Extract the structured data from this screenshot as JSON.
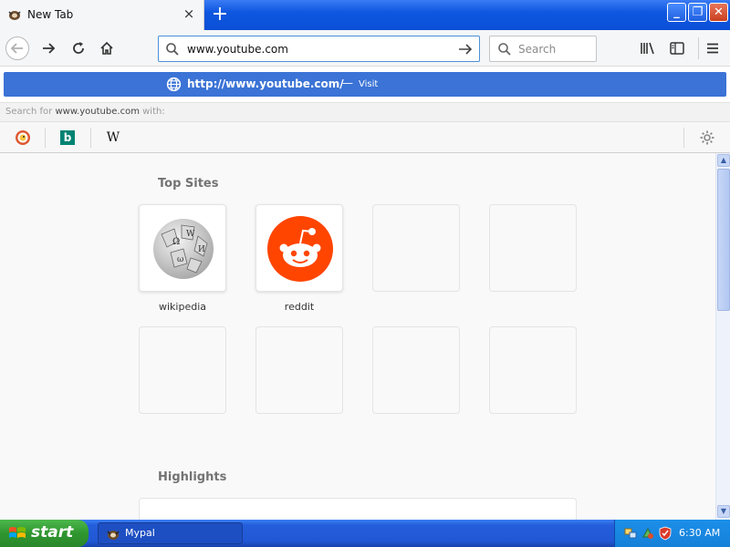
{
  "tab": {
    "title": "New Tab",
    "close": "×",
    "new_tab": "+"
  },
  "window_buttons": {
    "minimize": "_",
    "maximize": "❐",
    "close": "✕"
  },
  "urlbar": {
    "value": "www.youtube.com"
  },
  "searchbar": {
    "placeholder": "Search"
  },
  "autocomplete": {
    "url": "http://www.youtube.com/",
    "separator": "—",
    "action": "Visit"
  },
  "search_with": {
    "prefix": "Search for ",
    "term": "www.youtube.com",
    "suffix": " with:"
  },
  "engines": [
    {
      "name": "DuckDuckGo",
      "icon": "duckduckgo-icon"
    },
    {
      "name": "Bing",
      "icon": "bing-icon",
      "glyph": "b"
    },
    {
      "name": "Wikipedia",
      "icon": "wikipedia-icon",
      "glyph": "W"
    }
  ],
  "content": {
    "top_sites_title": "Top Sites",
    "top_sites": [
      {
        "label": "wikipedia",
        "icon": "wikipedia-globe-icon"
      },
      {
        "label": "reddit",
        "icon": "reddit-icon"
      }
    ],
    "empty_tile_count": 6,
    "highlights_title": "Highlights"
  },
  "taskbar": {
    "start_label": "start",
    "task_label": "Mypal",
    "clock": "6:30 AM"
  },
  "colors": {
    "accent": "#3b73d6",
    "titlebar": "#0a4fd6",
    "reddit": "#ff4500",
    "start_green": "#2f962f"
  }
}
